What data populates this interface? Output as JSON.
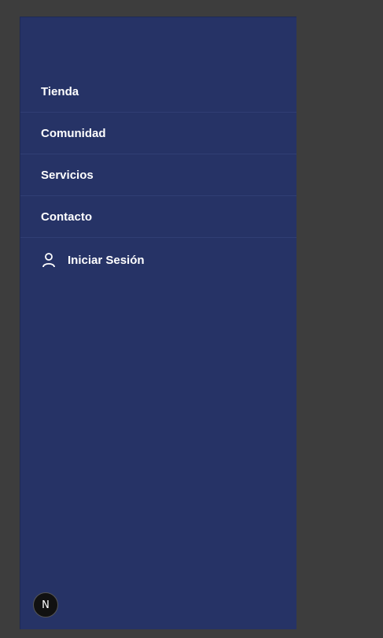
{
  "nav": {
    "items": [
      {
        "label": "Tienda"
      },
      {
        "label": "Comunidad"
      },
      {
        "label": "Servicios"
      },
      {
        "label": "Contacto"
      }
    ],
    "login": {
      "label": "Iniciar Sesión",
      "icon": "user-icon"
    }
  },
  "badge": {
    "letter": "N"
  },
  "colors": {
    "drawer_bg": "#263366",
    "page_bg": "#3d3d3d",
    "text": "#ffffff"
  }
}
